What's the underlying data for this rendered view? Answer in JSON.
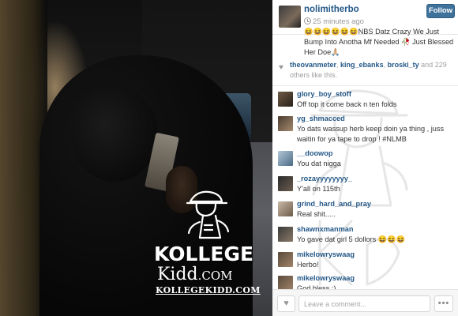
{
  "photo": {
    "watermark": {
      "kollege": "KOLLEGE",
      "kidd": "Kidd",
      "com": ".COM",
      "url": "KOLLEGEKIDD.COM"
    }
  },
  "post": {
    "username": "nolimitherbo",
    "time_ago": "25 minutes ago",
    "follow_label": "Follow",
    "caption": "😆😆😆😆😆😆NBS Datz Crazy We Just Bump Into Anotha Mf Needed 🥀 Just Blessed Her Doe🙏🏼",
    "likes": {
      "users": [
        "theovanmeter",
        "king_ebanks",
        "broski_ty"
      ],
      "connector": "and",
      "count": "229",
      "suffix": "others like this."
    }
  },
  "comments": [
    {
      "user": "glory_boy_stoff",
      "text": "Off top it come back n ten folds"
    },
    {
      "user": "yg_shmacced",
      "text": "Yo dats wassup herb keep doin ya thing , juss waitin for ya tape to drop ! #NLMB"
    },
    {
      "user": "__doowop",
      "text": "You dat nigga"
    },
    {
      "user": "_rozayyyyyyyy_",
      "text": "Y'all on 115th"
    },
    {
      "user": "grind_hard_and_pray",
      "text": "Real shit....."
    },
    {
      "user": "shawnxmanman",
      "text": "Yo gave dat girl 5 dollors 😆😆😆"
    },
    {
      "user": "mikelowryswaag",
      "text": "Herbo!"
    },
    {
      "user": "mikelowryswaag",
      "text": "God bless ;)"
    }
  ],
  "composer": {
    "placeholder": "Leave a comment...",
    "like_icon": "heart-icon",
    "more_icon": "more-icon"
  },
  "colors": {
    "link": "#245887",
    "follow_button": "#3f729b"
  }
}
